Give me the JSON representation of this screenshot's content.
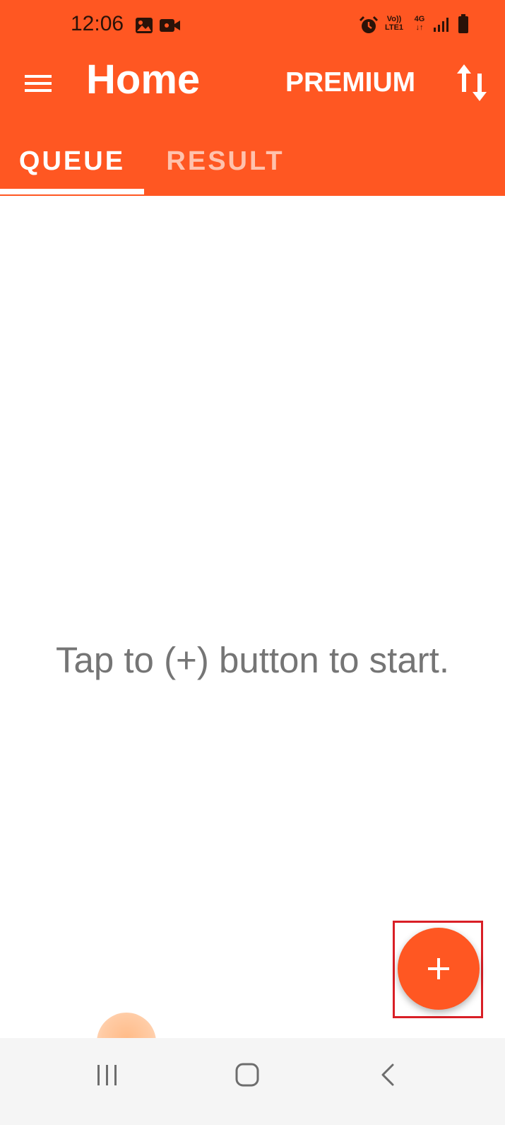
{
  "status_bar": {
    "time": "12:06",
    "icons": [
      "image-icon",
      "video-camera-icon",
      "alarm-icon",
      "volte-lte-icon",
      "4g-data-icon",
      "signal-icon",
      "battery-icon"
    ],
    "volte_label": "Vo))",
    "lte_label": "LTE1",
    "network_label": "4G"
  },
  "app_bar": {
    "menu_icon": "hamburger-menu-icon",
    "title": "Home",
    "premium_label": "PREMIUM",
    "sort_icon": "swap-vertical-icon",
    "color": "#ff5722"
  },
  "tabs": [
    {
      "label": "QUEUE",
      "selected": true
    },
    {
      "label": "RESULT",
      "selected": false
    }
  ],
  "main": {
    "empty_message": "Tap to (+) button to start."
  },
  "fab": {
    "icon": "plus-icon",
    "highlighted": true,
    "highlight_color": "#d91f26"
  },
  "nav_bar": {
    "items": [
      "recent-apps-icon",
      "home-icon",
      "back-icon"
    ]
  }
}
